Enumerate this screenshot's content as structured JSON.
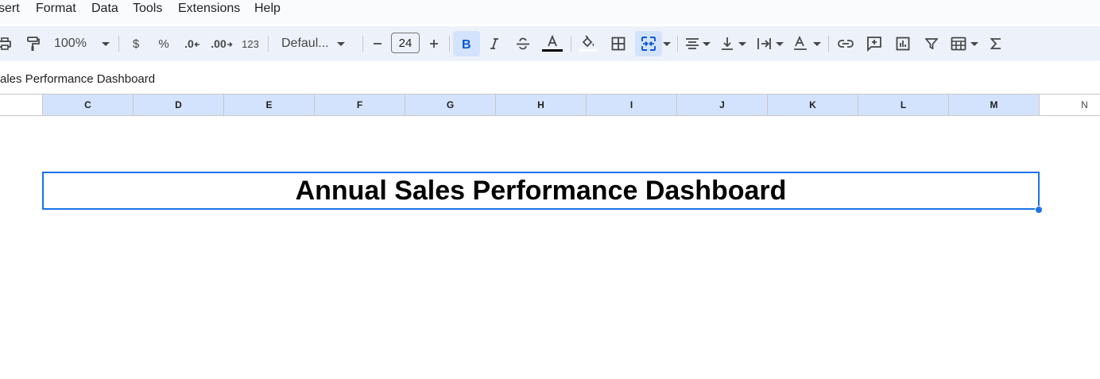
{
  "menu": {
    "items": [
      "sert",
      "Format",
      "Data",
      "Tools",
      "Extensions",
      "Help"
    ]
  },
  "toolbar": {
    "zoom": "100%",
    "currency": "$",
    "percent": "%",
    "decrease_decimal": ".0",
    "increase_decimal": ".00",
    "more_formats": "123",
    "font": "Defaul...",
    "font_size": "24",
    "active_buttons": [
      "bold",
      "merge-cells"
    ]
  },
  "formula_bar": {
    "content": "ales Performance Dashboard"
  },
  "columns": {
    "partial_left": "",
    "headers": [
      "C",
      "D",
      "E",
      "F",
      "G",
      "H",
      "I",
      "J",
      "K",
      "L",
      "M",
      "N"
    ],
    "selected": [
      "C",
      "D",
      "E",
      "F",
      "G",
      "H",
      "I",
      "J",
      "K",
      "L",
      "M"
    ]
  },
  "sheet": {
    "merged_cell_text": "Annual Sales Performance Dashboard"
  },
  "colors": {
    "accent": "#1a73e8",
    "selected_header": "#d3e3fd",
    "toolbar_bg": "#edf2fa"
  }
}
